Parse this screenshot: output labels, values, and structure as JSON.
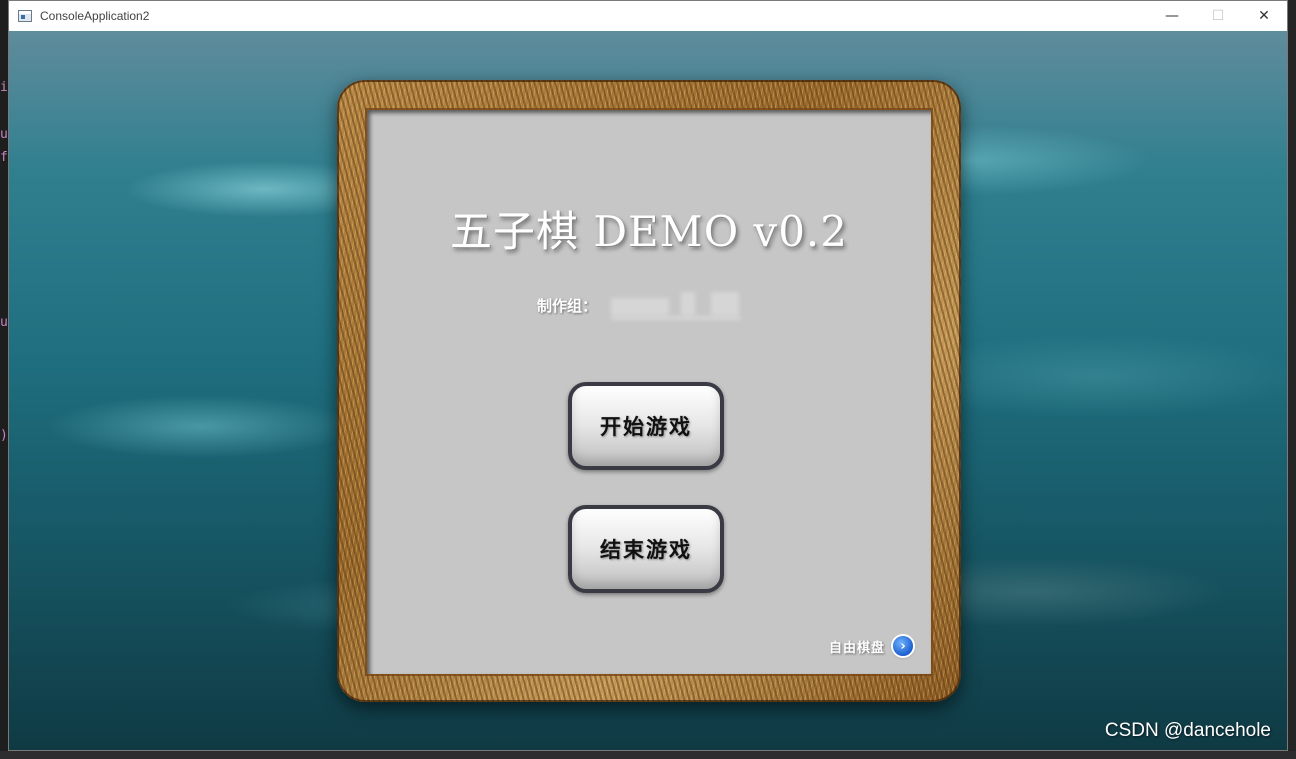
{
  "window": {
    "title": "ConsoleApplication2",
    "minimize": "—",
    "maximize": "☐",
    "close": "✕"
  },
  "game": {
    "title": "五子棋 DEMO v0.2",
    "credits_label": "制作组：",
    "start_button": "开始游戏",
    "exit_button": "结束游戏",
    "free_board_label": "自由棋盘",
    "free_board_icon": "chevron-right-circle-icon",
    "arrow_glyph": "›"
  },
  "editor_glimpse": [
    "i",
    "u",
    "f",
    "u",
    ")"
  ],
  "watermark": "CSDN @dancehole",
  "colors": {
    "panel": "#c6c6c6",
    "button_border": "#3a3a44",
    "accent_blue": "#1c5fd0"
  }
}
